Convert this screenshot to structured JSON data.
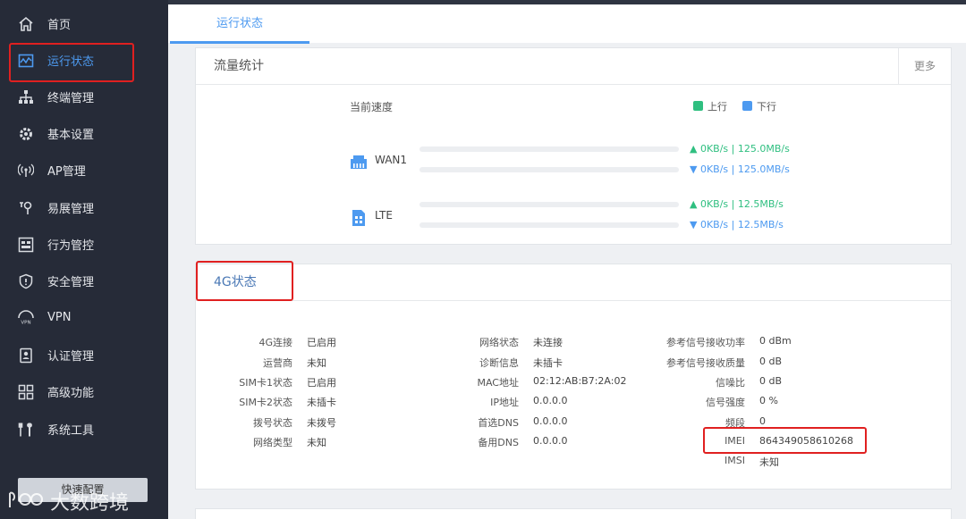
{
  "sidebar": {
    "items": [
      {
        "label": "首页",
        "icon": "home-icon"
      },
      {
        "label": "运行状态",
        "icon": "monitor-icon",
        "active": true
      },
      {
        "label": "终端管理",
        "icon": "network-icon"
      },
      {
        "label": "基本设置",
        "icon": "gear-icon"
      },
      {
        "label": "AP管理",
        "icon": "ap-icon"
      },
      {
        "label": "易展管理",
        "icon": "extend-icon"
      },
      {
        "label": "行为管控",
        "icon": "behavior-icon"
      },
      {
        "label": "安全管理",
        "icon": "shield-icon"
      },
      {
        "label": "VPN",
        "icon": "vpn-icon"
      },
      {
        "label": "认证管理",
        "icon": "auth-icon"
      },
      {
        "label": "高级功能",
        "icon": "grid-icon"
      },
      {
        "label": "系统工具",
        "icon": "tools-icon"
      }
    ],
    "quick_config": "快速配置"
  },
  "watermark": {
    "text": "大数跨境"
  },
  "tabs": [
    {
      "label": "运行状态"
    }
  ],
  "traffic": {
    "title": "流量统计",
    "more": "更多",
    "current_speed": "当前速度",
    "legend": {
      "up": "上行",
      "down": "下行",
      "up_color": "#2fbf80",
      "down_color": "#4d9af0"
    },
    "interfaces": [
      {
        "name": "WAN1",
        "up": "0KB/s | 125.0MB/s",
        "down": "0KB/s | 125.0MB/s"
      },
      {
        "name": "LTE",
        "up": "0KB/s | 12.5MB/s",
        "down": "0KB/s | 12.5MB/s"
      }
    ]
  },
  "status4g": {
    "title": "4G状态",
    "col1": [
      {
        "label": "4G连接",
        "value": "已启用"
      },
      {
        "label": "运营商",
        "value": "未知"
      },
      {
        "label": "SIM卡1状态",
        "value": "已启用"
      },
      {
        "label": "SIM卡2状态",
        "value": "未插卡"
      },
      {
        "label": "拨号状态",
        "value": "未拨号"
      },
      {
        "label": "网络类型",
        "value": "未知"
      }
    ],
    "col2": [
      {
        "label": "网络状态",
        "value": "未连接"
      },
      {
        "label": "诊断信息",
        "value": "未插卡"
      },
      {
        "label": "MAC地址",
        "value": "02:12:AB:B7:2A:02"
      },
      {
        "label": "IP地址",
        "value": "0.0.0.0"
      },
      {
        "label": "首选DNS",
        "value": "0.0.0.0"
      },
      {
        "label": "备用DNS",
        "value": "0.0.0.0"
      }
    ],
    "col3": [
      {
        "label": "参考信号接收功率",
        "value": "0 dBm"
      },
      {
        "label": "参考信号接收质量",
        "value": "0 dB"
      },
      {
        "label": "信噪比",
        "value": "0 dB"
      },
      {
        "label": "信号强度",
        "value": "0 %"
      },
      {
        "label": "频段",
        "value": "0"
      },
      {
        "label": "IMEI",
        "value": "864349058610268"
      },
      {
        "label": "IMSI",
        "value": "未知"
      }
    ]
  }
}
